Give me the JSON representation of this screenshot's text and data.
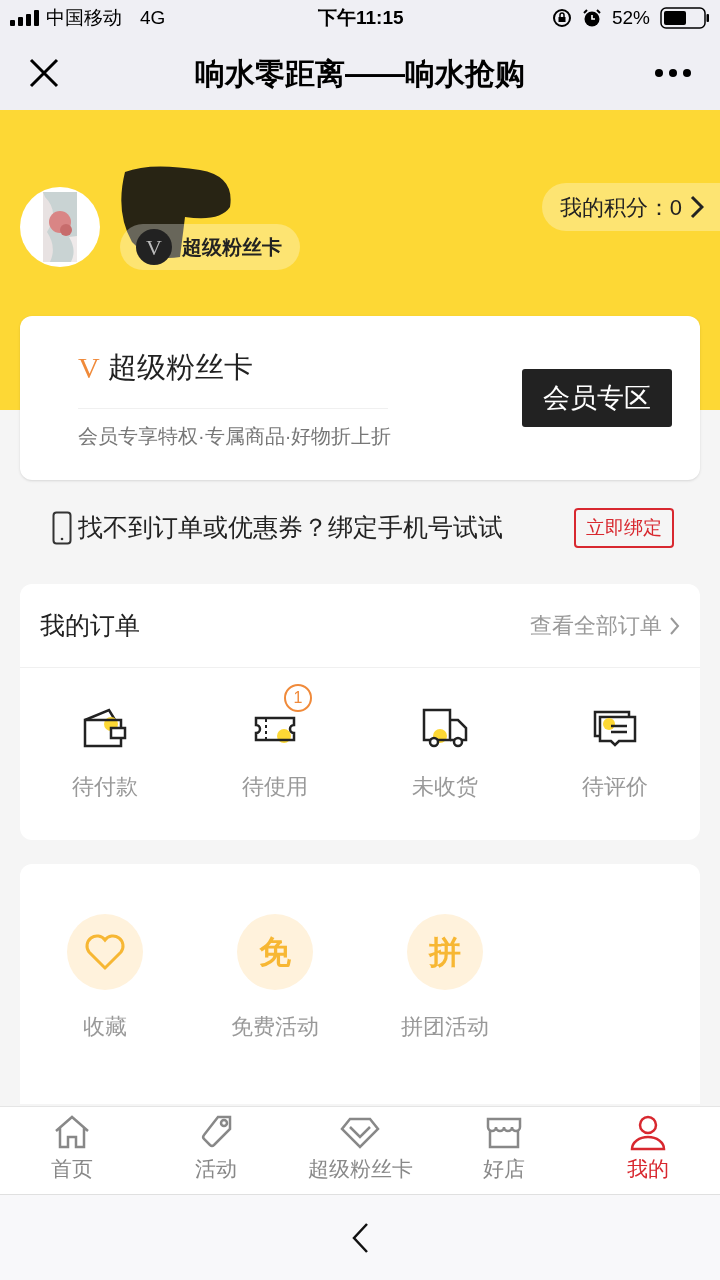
{
  "status_bar": {
    "carrier": "中国移动",
    "network": "4G",
    "time": "下午11:15",
    "battery": "52%"
  },
  "nav_bar": {
    "title": "响水零距离——响水抢购"
  },
  "profile": {
    "card_badge": "超级粉丝卡",
    "card_badge_mark": "V",
    "points": "我的积分：0"
  },
  "member_card": {
    "mark": "V",
    "title": "超级粉丝卡",
    "subtitle": "会员专享特权·专属商品·好物折上折",
    "button": "会员专区"
  },
  "bind_prompt": {
    "text": "找不到订单或优惠券？绑定手机号试试",
    "button": "立即绑定"
  },
  "orders": {
    "title": "我的订单",
    "view_all": "查看全部订单",
    "items": [
      {
        "kind": "wallet",
        "label": "待付款"
      },
      {
        "kind": "ticket",
        "label": "待使用",
        "badge": "1"
      },
      {
        "kind": "truck",
        "label": "未收货"
      },
      {
        "kind": "comment",
        "label": "待评价"
      }
    ]
  },
  "services": [
    {
      "kind": "heart",
      "label": "收藏"
    },
    {
      "kind": "char",
      "glyph": "免",
      "label": "免费活动"
    },
    {
      "kind": "char",
      "glyph": "拼",
      "label": "拼团活动"
    }
  ],
  "tab_bar": [
    {
      "kind": "home",
      "label": "首页",
      "selected": false
    },
    {
      "kind": "tag",
      "label": "活动",
      "selected": false
    },
    {
      "kind": "diamond",
      "label": "超级粉丝卡",
      "selected": false
    },
    {
      "kind": "shop",
      "label": "好店",
      "selected": false
    },
    {
      "kind": "person",
      "label": "我的",
      "selected": true
    }
  ]
}
